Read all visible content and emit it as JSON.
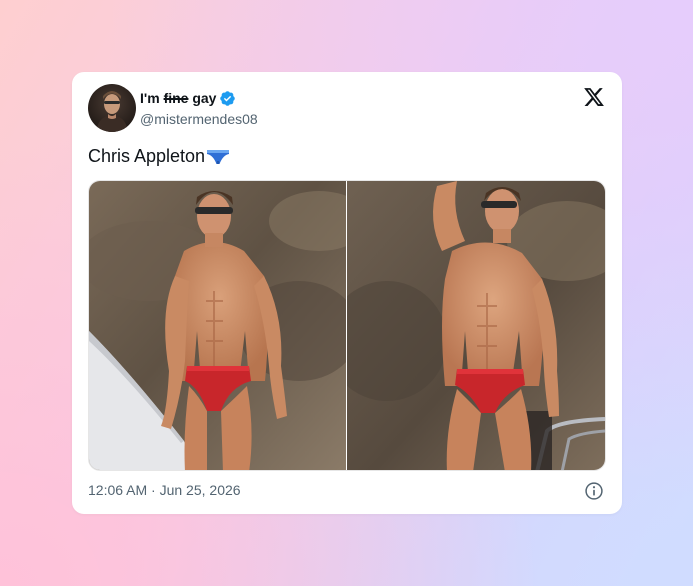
{
  "tweet": {
    "author": {
      "display_name_prefix": "I'm ",
      "display_name_struck": "fine",
      "display_name_suffix": " gay",
      "handle": "@mistermendes08",
      "verified": true,
      "verified_color": "#1d9bf0"
    },
    "text": "Chris Appleton",
    "emoji": "briefs",
    "media": [
      {
        "type": "photo",
        "description": "man in red swim briefs on a boat, facing forward"
      },
      {
        "type": "photo",
        "description": "man in red swim briefs on a boat, arm raised"
      }
    ],
    "timestamp": "12:06 AM · Jun 25, 2026",
    "logo": "x-logo",
    "info": "info-icon"
  },
  "colors": {
    "text_primary": "#0f1419",
    "text_secondary": "#536471",
    "accent": "#1d9bf0"
  }
}
